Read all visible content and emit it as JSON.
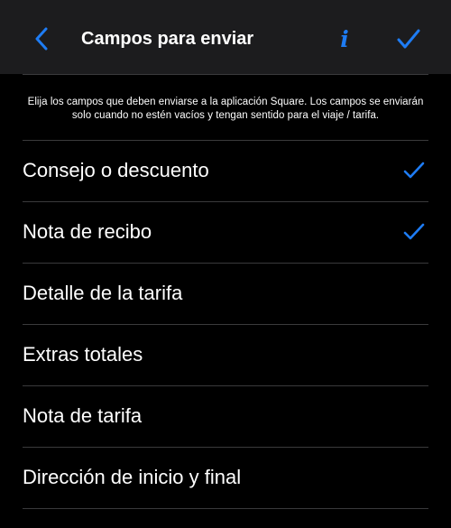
{
  "colors": {
    "accent": "#1e7cf4",
    "background": "#000000",
    "navbar": "#1c1c1e",
    "separator": "#3a3a3c",
    "text": "#ffffff"
  },
  "navbar": {
    "back_icon": "chevron-left-icon",
    "title": "Campos para enviar",
    "info_icon": "info-icon",
    "info_glyph": "i",
    "done_icon": "checkmark-icon"
  },
  "description": "Elija los campos que deben enviarse a la aplicación Square. Los campos se enviarán solo cuando no estén vacíos y tengan sentido para el viaje / tarifa.",
  "fields": [
    {
      "id": "tip-discount",
      "label": "Consejo o descuento",
      "checked": true
    },
    {
      "id": "receipt-note",
      "label": "Nota de recibo",
      "checked": true
    },
    {
      "id": "fare-detail",
      "label": "Detalle de la tarifa",
      "checked": false
    },
    {
      "id": "total-extras",
      "label": "Extras totales",
      "checked": false
    },
    {
      "id": "fare-note",
      "label": "Nota de tarifa",
      "checked": false
    },
    {
      "id": "start-end-address",
      "label": "Dirección de inicio y final",
      "checked": false
    }
  ]
}
